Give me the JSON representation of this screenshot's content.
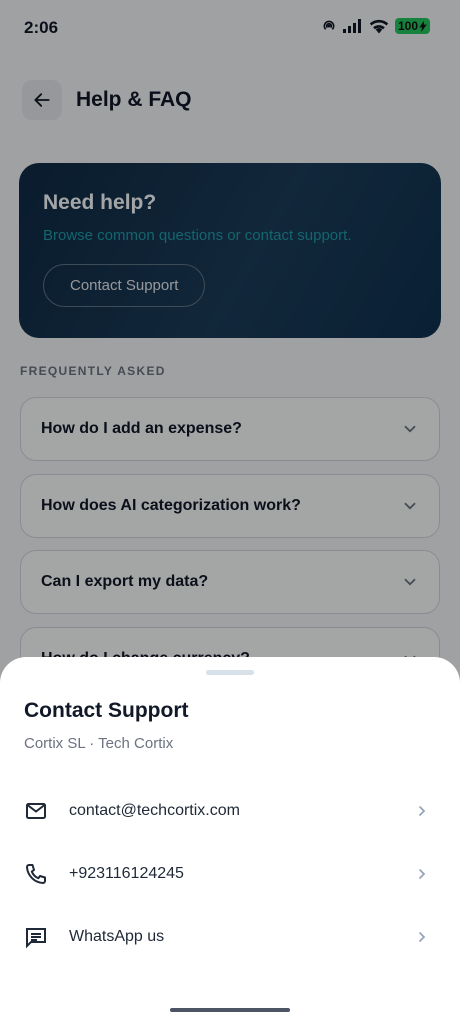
{
  "status_bar": {
    "time": "2:06",
    "battery": "100"
  },
  "header": {
    "title": "Help & FAQ"
  },
  "help_card": {
    "title": "Need help?",
    "subtitle": "Browse common questions or contact support.",
    "button_label": "Contact Support"
  },
  "faq": {
    "section_label": "FREQUENTLY ASKED",
    "items": [
      {
        "question": "How do I add an expense?"
      },
      {
        "question": "How does AI categorization work?"
      },
      {
        "question": "Can I export my data?"
      },
      {
        "question": "How do I change currency?"
      }
    ]
  },
  "sheet": {
    "title": "Contact Support",
    "subtitle": "Cortix SL · Tech Cortix",
    "options": [
      {
        "icon": "mail-icon",
        "label": "contact@techcortix.com"
      },
      {
        "icon": "phone-icon",
        "label": "+923116124245"
      },
      {
        "icon": "chat-icon",
        "label": "WhatsApp us"
      }
    ]
  },
  "colors": {
    "card_gradient_start": "#0f2a45",
    "card_subtitle": "#1e9aa8",
    "battery_green": "#22c55e",
    "sheet_background": "#ffffff"
  }
}
